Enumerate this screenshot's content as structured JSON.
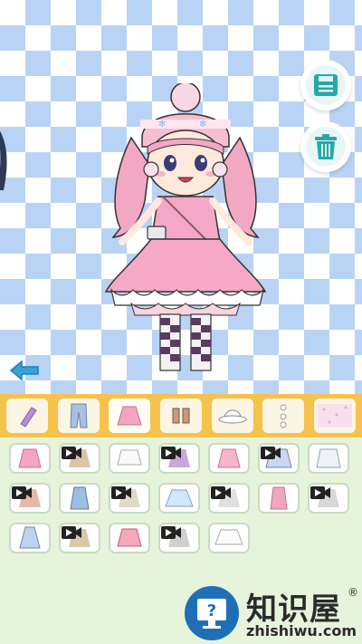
{
  "toolbar": {
    "save_icon": "save-icon",
    "delete_icon": "trash-icon",
    "back_icon": "arrow-left-icon"
  },
  "colors": {
    "accent": "#25a9a6",
    "category_bar": "#f6c24b",
    "panel": "#e7f4dc",
    "checker": "#b9d3f5",
    "back_arrow": "#3aa0d8"
  },
  "categories": [
    {
      "icon": "accessory-bottle-icon",
      "selected": false
    },
    {
      "icon": "pants-icon",
      "selected": false
    },
    {
      "icon": "skirt-icon",
      "selected": true
    },
    {
      "icon": "shoes-icon",
      "selected": false
    },
    {
      "icon": "hat-icon",
      "selected": false
    },
    {
      "icon": "hair-clip-icon",
      "selected": false
    },
    {
      "icon": "background-icon",
      "selected": false
    }
  ],
  "items": [
    {
      "icon": "pink-skirt-icon",
      "video_locked": false
    },
    {
      "icon": "skirt-icon",
      "video_locked": true
    },
    {
      "icon": "white-skirt-icon",
      "video_locked": false
    },
    {
      "icon": "skirt-icon",
      "video_locked": true
    },
    {
      "icon": "pink-floral-skirt-icon",
      "video_locked": false
    },
    {
      "icon": "blue-floral-skirt-icon",
      "video_locked": true
    },
    {
      "icon": "white-frill-skirt-icon",
      "video_locked": false
    },
    {
      "icon": "skirt-icon",
      "video_locked": true
    },
    {
      "icon": "denim-overall-icon",
      "video_locked": false
    },
    {
      "icon": "skirt-icon",
      "video_locked": true
    },
    {
      "icon": "blue-tutu-skirt-icon",
      "video_locked": false
    },
    {
      "icon": "skirt-icon",
      "video_locked": true
    },
    {
      "icon": "pink-long-skirt-icon",
      "video_locked": false
    },
    {
      "icon": "skirt-icon",
      "video_locked": true
    },
    {
      "icon": "blue-dress-icon",
      "video_locked": false
    },
    {
      "icon": "skirt-icon",
      "video_locked": true
    },
    {
      "icon": "pink-pattern-skirt-icon",
      "video_locked": false
    },
    {
      "icon": "skirt-icon",
      "video_locked": true
    },
    {
      "icon": "white-tutu-skirt-icon",
      "video_locked": false
    }
  ],
  "watermark": {
    "title": "知识屋",
    "subtitle": "zhishiwu.com",
    "registered": "®"
  }
}
